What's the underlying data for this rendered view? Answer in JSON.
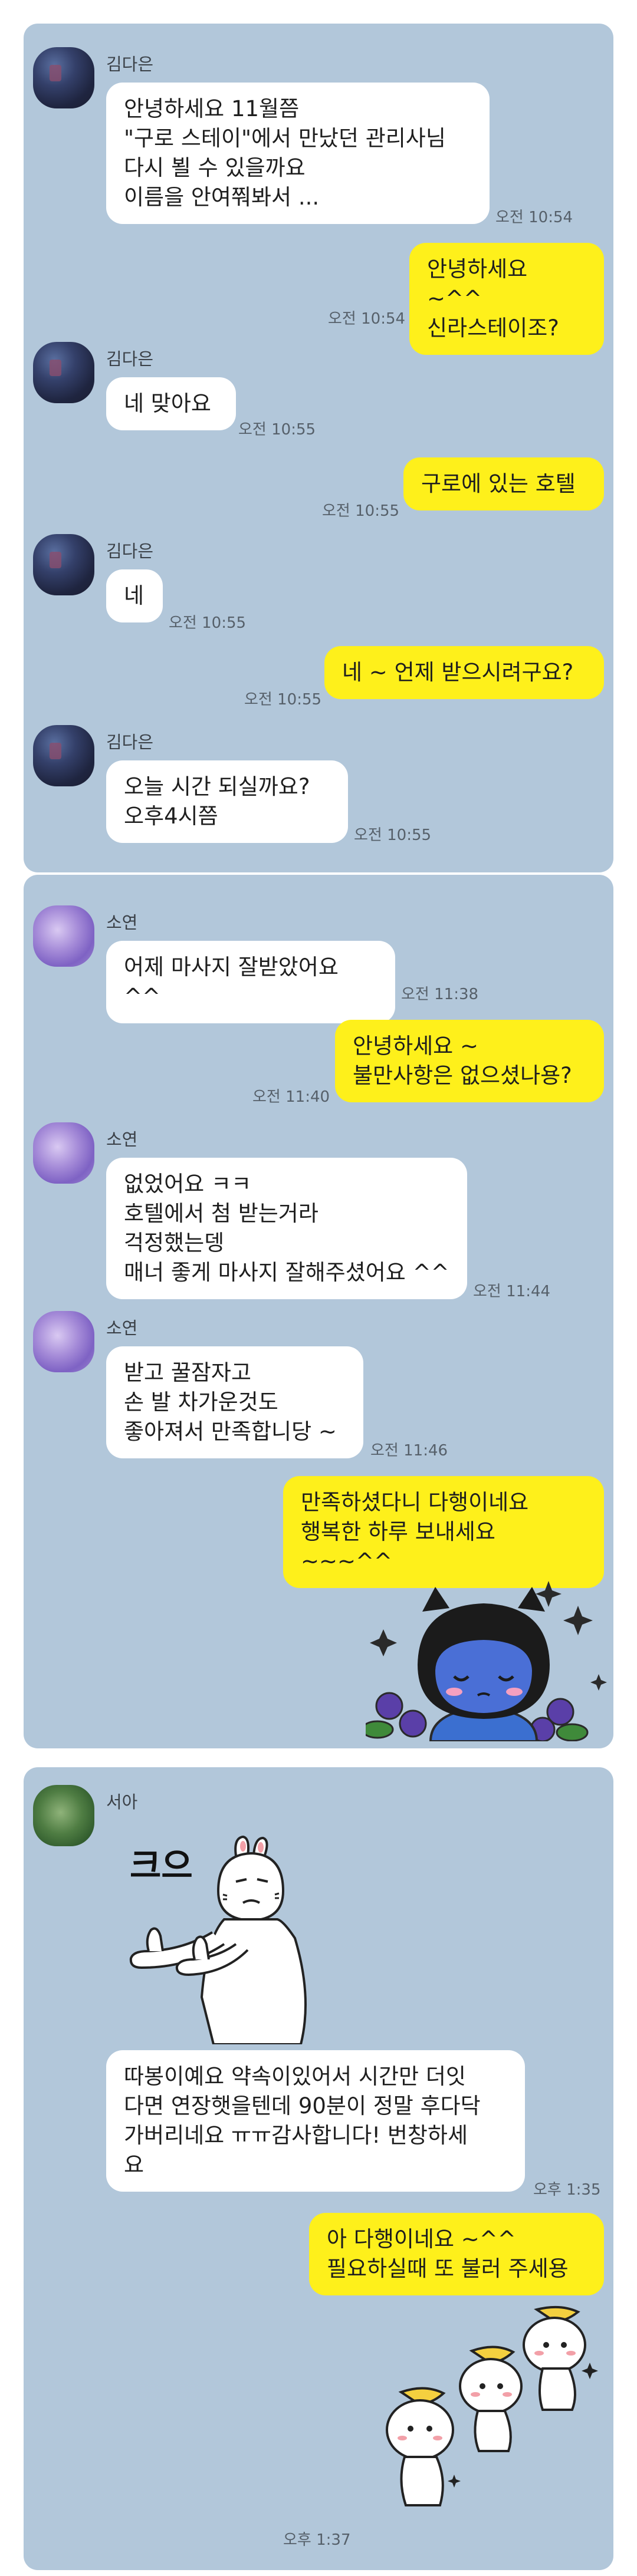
{
  "conversations": [
    {
      "messages": [
        {
          "sender": "김다은",
          "text": "안녕하세요 11월쯤\n\"구로 스테이\"에서 만났던 관리사님\n다시 뵐 수 있을까요\n이름을 안여쭤봐서 ...",
          "time": "오전 10:54"
        },
        {
          "sender": "me",
          "text": "안녕하세요 ~^^\n신라스테이조?",
          "time": "오전 10:54"
        },
        {
          "sender": "김다은",
          "text": "네 맞아요",
          "time": "오전 10:55"
        },
        {
          "sender": "me",
          "text": "구로에 있는 호텔",
          "time": "오전 10:55"
        },
        {
          "sender": "김다은",
          "text": "네",
          "time": "오전 10:55"
        },
        {
          "sender": "me",
          "text": "네 ~ 언제 받으시려구요?",
          "time": "오전 10:55"
        },
        {
          "sender": "김다은",
          "text": "오늘  시간 되실까요?\n오후4시쯤",
          "time": "오전 10:55"
        }
      ]
    },
    {
      "messages": [
        {
          "sender": "소연",
          "text": "어제 마사지 잘받았어요 ^^",
          "time": "오전 11:38"
        },
        {
          "sender": "me",
          "text": "안녕하세요 ~\n불만사항은 없으셨나용?",
          "time": "오전 11:40"
        },
        {
          "sender": "소연",
          "text": "없었어요 ㅋㅋ\n호텔에서 첨 받는거라\n걱정했는뎅\n매너 좋게 마사지 잘해주셨어요 ^^",
          "time": "오전 11:44"
        },
        {
          "sender": "소연",
          "text": "받고 꿀잠자고\n손 발 차가운것도\n좋아져서 만족합니당 ~",
          "time": "오전 11:46"
        },
        {
          "sender": "me",
          "text": "만족하셨다니 다행이네요\n행복한 하루 보내세요 ~~~^^",
          "time": ""
        }
      ]
    },
    {
      "messages": [
        {
          "sender": "서아",
          "sticker_text": "크으",
          "text": "따봉이예요 약속이있어서 시간만 더잇\n다면 연장햇을텐데 90분이 정말 후다닥\n가버리네요 ㅠㅠ감사합니다! 번창하세\n요",
          "time": "오후 1:35"
        },
        {
          "sender": "me",
          "text": "아 다행이네요 ~^^\n필요하실때 또 불러 주세용",
          "time": "오후 1:37"
        }
      ]
    }
  ],
  "colors": {
    "background": "#b2c7da",
    "incoming": "#ffffff",
    "outgoing": "#fef01b"
  },
  "icons": [
    "blurred-avatar",
    "crying-character-sticker",
    "thumbs-up-sticker",
    "bunny-group-sticker"
  ]
}
